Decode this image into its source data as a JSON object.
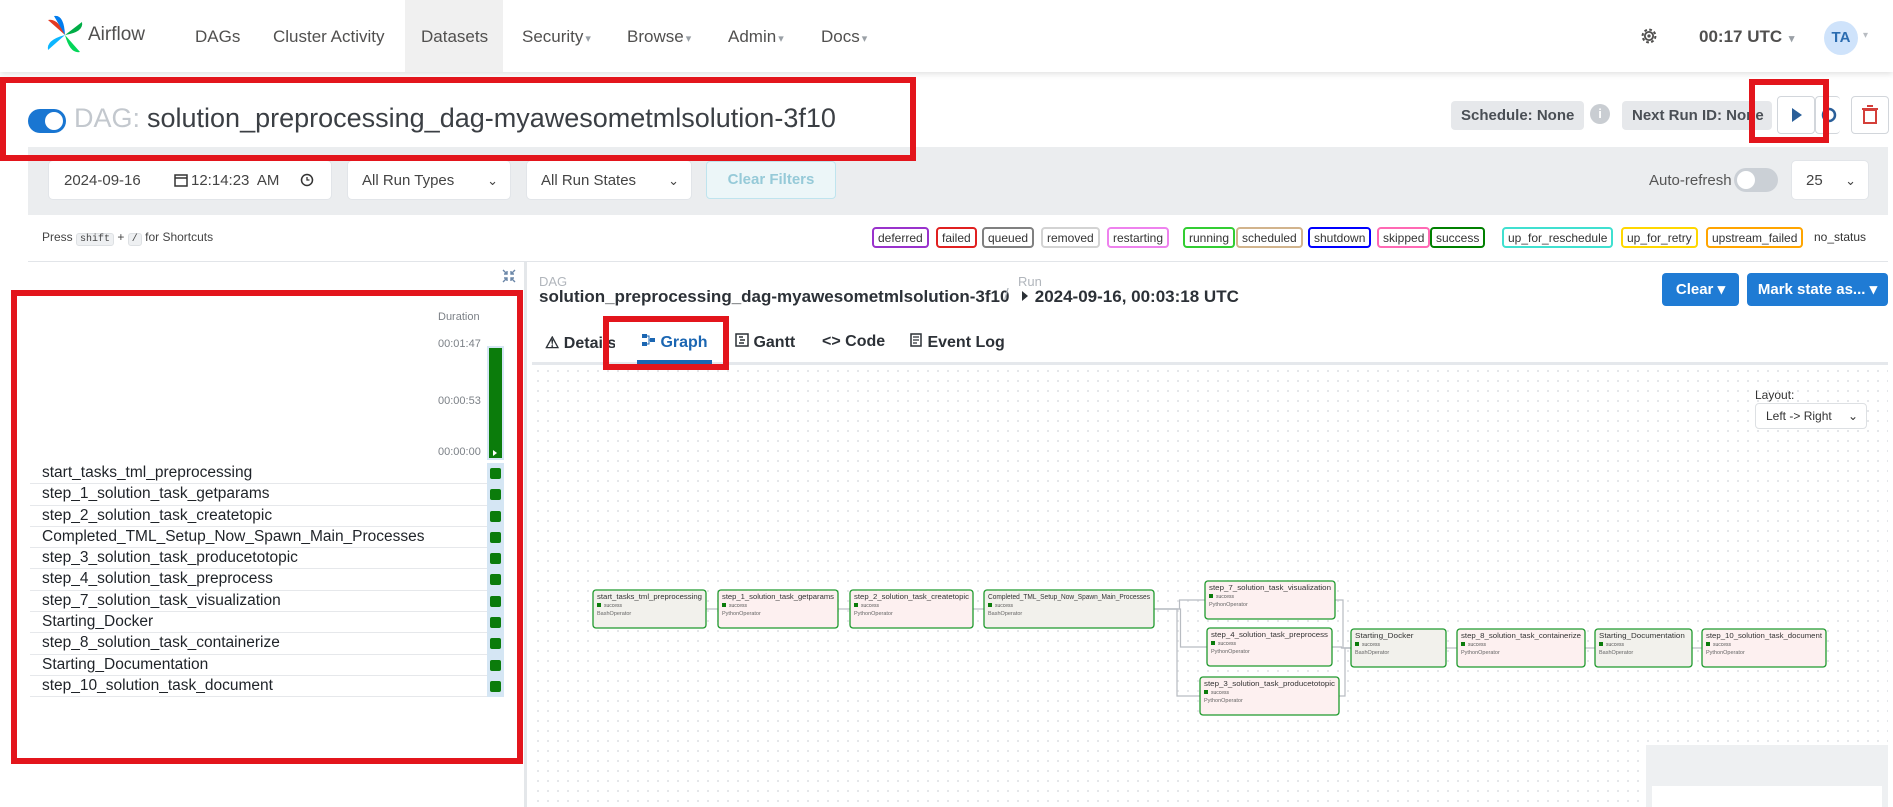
{
  "nav": {
    "brand": "Airflow",
    "items": [
      {
        "label": "DAGs",
        "caret": ""
      },
      {
        "label": "Cluster Activity",
        "caret": ""
      },
      {
        "label": "Datasets",
        "caret": ""
      },
      {
        "label": "Security",
        "caret": "▾"
      },
      {
        "label": "Browse",
        "caret": "▾"
      },
      {
        "label": "Admin",
        "caret": "▾"
      },
      {
        "label": "Docs",
        "caret": "▾"
      }
    ],
    "time": "00:17 UTC",
    "time_caret": "▾",
    "avatar": "TA",
    "avatar_caret": "▾"
  },
  "dag": {
    "prefix": "DAG:",
    "name": "solution_preprocessing_dag-myawesometmlsolution-3f10",
    "schedule": "Schedule: None",
    "next_run": "Next Run ID: None",
    "paused": false
  },
  "filters": {
    "date": "2024-09-16",
    "time": "12:14:23  AM",
    "run_types": "All Run Types",
    "run_states": "All Run States",
    "clear": "Clear Filters",
    "autorefresh": "Auto-refresh",
    "num_runs": "25"
  },
  "shortcuts": {
    "press": "Press",
    "key1": "shift",
    "plus": "+",
    "key2": "/",
    "suffix": "for Shortcuts"
  },
  "states": [
    {
      "label": "deferred",
      "color": "#9932cc"
    },
    {
      "label": "failed",
      "color": "#e02020"
    },
    {
      "label": "queued",
      "color": "#808080"
    },
    {
      "label": "removed",
      "color": "#d3d3d3"
    },
    {
      "label": "restarting",
      "color": "#ee82ee"
    },
    {
      "label": "running",
      "color": "#32cd32"
    },
    {
      "label": "scheduled",
      "color": "#d2b48c"
    },
    {
      "label": "shutdown",
      "color": "#0000ff"
    },
    {
      "label": "skipped",
      "color": "#ff69b4"
    },
    {
      "label": "success",
      "color": "#008000"
    },
    {
      "label": "up_for_reschedule",
      "color": "#40e0d0"
    },
    {
      "label": "up_for_retry",
      "color": "#ffd700"
    },
    {
      "label": "upstream_failed",
      "color": "#ffa500"
    }
  ],
  "no_status": "no_status",
  "grid": {
    "duration_label": "Duration",
    "ticks": [
      "00:01:47",
      "00:00:53",
      "00:00:00"
    ],
    "tasks": [
      "start_tasks_tml_preprocessing",
      "step_1_solution_task_getparams",
      "step_2_solution_task_createtopic",
      "Completed_TML_Setup_Now_Spawn_Main_Processes",
      "step_3_solution_task_producetotopic",
      "step_4_solution_task_preprocess",
      "step_7_solution_task_visualization",
      "Starting_Docker",
      "step_8_solution_task_containerize",
      "Starting_Documentation",
      "step_10_solution_task_document"
    ]
  },
  "details": {
    "dag_label": "DAG",
    "run_label": "Run",
    "dag_name": "solution_preprocessing_dag-myawesometmlsolution-3f10",
    "slash": "/",
    "run": "2024-09-16, 00:03:18 UTC",
    "clear_btn": "Clear",
    "mark_btn": "Mark state as...",
    "tabs": [
      "Details",
      "Graph",
      "Gantt",
      "Code",
      "Event Log"
    ],
    "layout_label": "Layout:",
    "layout_value": "Left -> Right"
  },
  "graph": {
    "state": "success",
    "nodes": [
      {
        "id": "start_tasks_tml_preprocessing",
        "op": "BashOperator"
      },
      {
        "id": "step_1_solution_task_getparams",
        "op": "PythonOperator"
      },
      {
        "id": "step_2_solution_task_createtopic",
        "op": "PythonOperator"
      },
      {
        "id": "Completed_TML_Setup_Now_Spawn_Main_Processes",
        "op": "BashOperator"
      },
      {
        "id": "step_7_solution_task_visualization",
        "op": "PythonOperator"
      },
      {
        "id": "step_4_solution_task_preprocess",
        "op": "PythonOperator"
      },
      {
        "id": "step_3_solution_task_producetotopic",
        "op": "PythonOperator"
      },
      {
        "id": "Starting_Docker",
        "op": "BashOperator"
      },
      {
        "id": "step_8_solution_task_containerize",
        "op": "PythonOperator"
      },
      {
        "id": "Starting_Documentation",
        "op": "BashOperator"
      },
      {
        "id": "step_10_solution_task_document",
        "op": "PythonOperator"
      }
    ]
  }
}
